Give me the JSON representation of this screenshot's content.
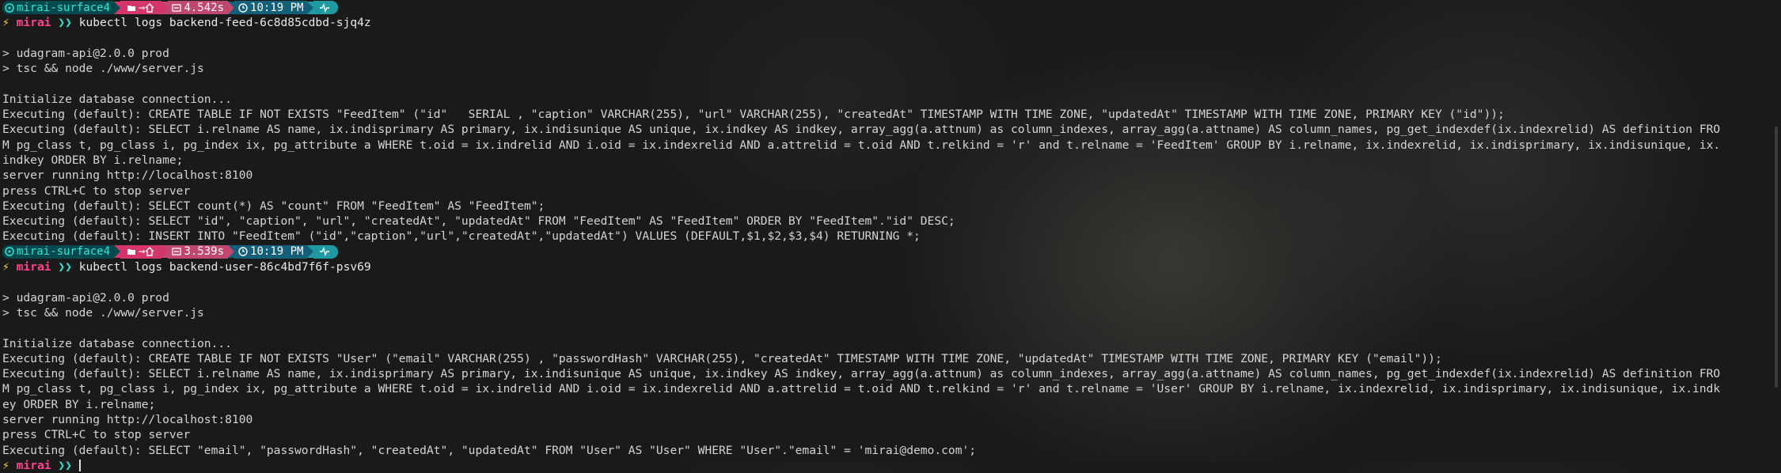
{
  "colors": {
    "background": "#1a1a1b",
    "text": "#d4d4d4",
    "host_segment": "#004a4d",
    "path_segment": "#d4366b",
    "clock_segment": "#13607a",
    "status_segment": "#1e9aa0",
    "bolt": "#ffd13b",
    "user": "#ff3f8e"
  },
  "icons": {
    "host": "ubuntu-icon",
    "folder": "folder-icon",
    "arrow": "arrow-right-icon",
    "home": "home-icon",
    "timer": "stopwatch-icon",
    "clock": "clock-icon",
    "status": "pulse-icon",
    "bolt": "lightning-bolt-icon"
  },
  "blocks": [
    {
      "prompt": {
        "host": "mirai-surface4",
        "arrow": "→",
        "duration": "4.542s",
        "clock": "10:19 PM"
      },
      "user": "mirai",
      "chevron": "❯❯",
      "command": "kubectl logs backend-feed-6c8d85cdbd-sjq4z",
      "output": [
        "",
        "> udagram-api@2.0.0 prod",
        "> tsc && node ./www/server.js",
        "",
        "Initialize database connection...",
        "Executing (default): CREATE TABLE IF NOT EXISTS \"FeedItem\" (\"id\"   SERIAL , \"caption\" VARCHAR(255), \"url\" VARCHAR(255), \"createdAt\" TIMESTAMP WITH TIME ZONE, \"updatedAt\" TIMESTAMP WITH TIME ZONE, PRIMARY KEY (\"id\"));",
        "Executing (default): SELECT i.relname AS name, ix.indisprimary AS primary, ix.indisunique AS unique, ix.indkey AS indkey, array_agg(a.attnum) as column_indexes, array_agg(a.attname) AS column_names, pg_get_indexdef(ix.indexrelid) AS definition FRO",
        "M pg_class t, pg_class i, pg_index ix, pg_attribute a WHERE t.oid = ix.indrelid AND i.oid = ix.indexrelid AND a.attrelid = t.oid AND t.relkind = 'r' and t.relname = 'FeedItem' GROUP BY i.relname, ix.indexrelid, ix.indisprimary, ix.indisunique, ix.",
        "indkey ORDER BY i.relname;",
        "server running http://localhost:8100",
        "press CTRL+C to stop server",
        "Executing (default): SELECT count(*) AS \"count\" FROM \"FeedItem\" AS \"FeedItem\";",
        "Executing (default): SELECT \"id\", \"caption\", \"url\", \"createdAt\", \"updatedAt\" FROM \"FeedItem\" AS \"FeedItem\" ORDER BY \"FeedItem\".\"id\" DESC;",
        "Executing (default): INSERT INTO \"FeedItem\" (\"id\",\"caption\",\"url\",\"createdAt\",\"updatedAt\") VALUES (DEFAULT,$1,$2,$3,$4) RETURNING *;"
      ]
    },
    {
      "prompt": {
        "host": "mirai-surface4",
        "arrow": "→",
        "duration": "3.539s",
        "clock": "10:19 PM"
      },
      "user": "mirai",
      "chevron": "❯❯",
      "command": "kubectl logs backend-user-86c4bd7f6f-psv69",
      "output": [
        "",
        "> udagram-api@2.0.0 prod",
        "> tsc && node ./www/server.js",
        "",
        "Initialize database connection...",
        "Executing (default): CREATE TABLE IF NOT EXISTS \"User\" (\"email\" VARCHAR(255) , \"passwordHash\" VARCHAR(255), \"createdAt\" TIMESTAMP WITH TIME ZONE, \"updatedAt\" TIMESTAMP WITH TIME ZONE, PRIMARY KEY (\"email\"));",
        "Executing (default): SELECT i.relname AS name, ix.indisprimary AS primary, ix.indisunique AS unique, ix.indkey AS indkey, array_agg(a.attnum) as column_indexes, array_agg(a.attname) AS column_names, pg_get_indexdef(ix.indexrelid) AS definition FRO",
        "M pg_class t, pg_class i, pg_index ix, pg_attribute a WHERE t.oid = ix.indrelid AND i.oid = ix.indexrelid AND a.attrelid = t.oid AND t.relkind = 'r' and t.relname = 'User' GROUP BY i.relname, ix.indexrelid, ix.indisprimary, ix.indisunique, ix.indk",
        "ey ORDER BY i.relname;",
        "server running http://localhost:8100",
        "press CTRL+C to stop server",
        "Executing (default): SELECT \"email\", \"passwordHash\", \"createdAt\", \"updatedAt\" FROM \"User\" AS \"User\" WHERE \"User\".\"email\" = 'mirai@demo.com';"
      ]
    }
  ],
  "current_prompt": {
    "user": "mirai",
    "chevron": "❯❯"
  }
}
